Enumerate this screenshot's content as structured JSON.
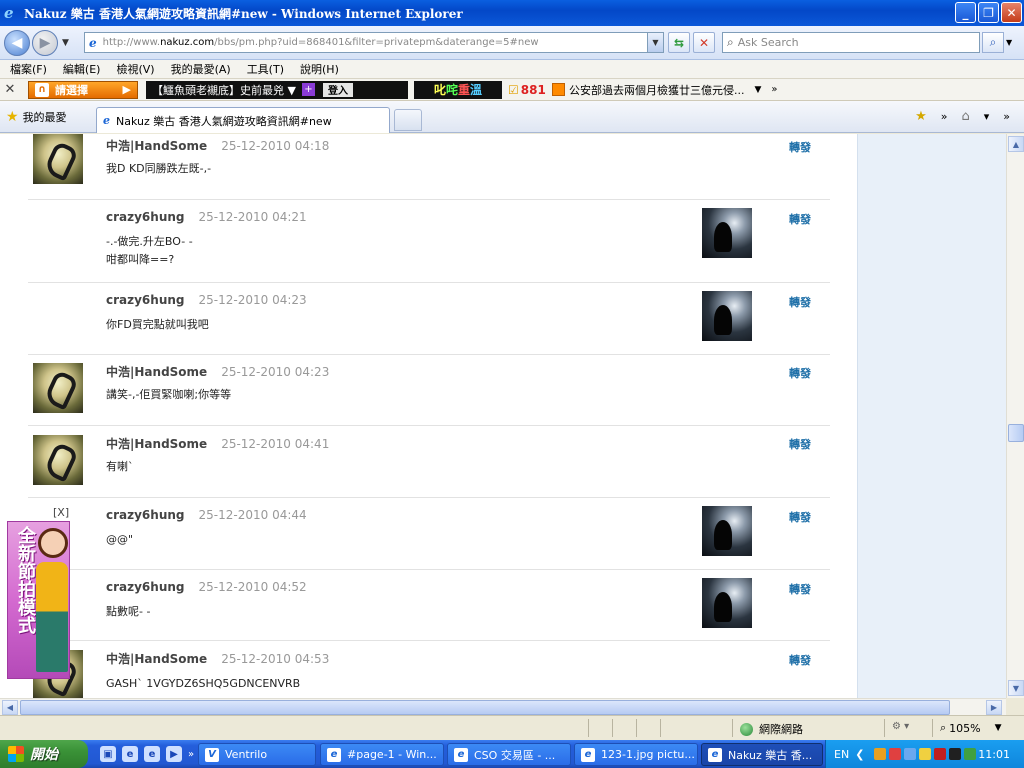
{
  "window": {
    "title": "Nakuz 樂古 香港人氣網遊攻略資訊網#new - Windows Internet Explorer",
    "controls": [
      "_",
      "❐",
      "✕"
    ]
  },
  "address": {
    "url_prefix": "http://www.",
    "url_host": "nakuz.com",
    "url_rest": "/bbs/pm.php?uid=868401&filter=privatepm&daterange=5#new",
    "search_placeholder": "Ask Search"
  },
  "menu": {
    "items": [
      "檔案(F)",
      "編輯(E)",
      "檢視(V)",
      "我的最愛(A)",
      "工具(T)",
      "說明(H)"
    ]
  },
  "toolbar": {
    "choose_label": "請選擇",
    "ticker_text": "【鱷魚頭老襯底】史前最兇 ▼",
    "login_label": "登入",
    "radio_chars": [
      "叱",
      "咤",
      "重",
      "溫"
    ],
    "station": "881",
    "news": "公安部過去兩個月檢獲廿三億元侵...",
    "more": "»"
  },
  "tabs": {
    "favorites_label": "我的最愛",
    "active_tab": "Nakuz 樂古 香港人氣網遊攻略資訊網#new"
  },
  "messages": [
    {
      "user": "中浩|HandSome",
      "time": "25-12-2010 04:18",
      "lines": [
        "我D KD同勝跌左既-,-"
      ],
      "side": "left",
      "forward": "轉發"
    },
    {
      "user": "crazy6hung",
      "time": "25-12-2010 04:21",
      "lines": [
        "-.-做完.升左BO- -",
        "咁都叫降==?"
      ],
      "side": "right",
      "forward": "轉發"
    },
    {
      "user": "crazy6hung",
      "time": "25-12-2010 04:23",
      "lines": [
        "你FD買完點就叫我吧"
      ],
      "side": "right",
      "forward": "轉發"
    },
    {
      "user": "中浩|HandSome",
      "time": "25-12-2010 04:23",
      "lines": [
        "講笑-,-佢買緊咖喇;你等等"
      ],
      "side": "left",
      "forward": "轉發"
    },
    {
      "user": "中浩|HandSome",
      "time": "25-12-2010 04:41",
      "lines": [
        "有喇`"
      ],
      "side": "left",
      "forward": "轉發"
    },
    {
      "user": "crazy6hung",
      "time": "25-12-2010 04:44",
      "lines": [
        "@@\""
      ],
      "side": "right",
      "forward": "轉發"
    },
    {
      "user": "crazy6hung",
      "time": "25-12-2010 04:52",
      "lines": [
        "點數呢- -"
      ],
      "side": "right",
      "forward": "轉發"
    },
    {
      "user": "中浩|HandSome",
      "time": "25-12-2010 04:53",
      "lines": [
        "GASH` 1VGYDZ6SHQ5GDNCENVRB"
      ],
      "side": "left",
      "forward": "轉發"
    }
  ],
  "ad": {
    "close_label": "[X]",
    "text": "全新節拍模式"
  },
  "status": {
    "zone": "網際網路",
    "zoom": "105%"
  },
  "taskbar": {
    "start_label": "開始",
    "tasks": [
      "Ventrilo",
      "#page-1 - Win...",
      "CSO 交易區 - ...",
      "123-1.jpg pictu...",
      "Nakuz 樂古 香..."
    ],
    "lang": "EN",
    "clock": "11:01"
  }
}
